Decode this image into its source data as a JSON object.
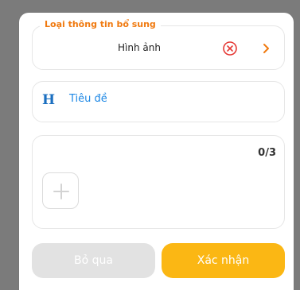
{
  "dialog": {
    "type_field": {
      "label": "Loại thông tin bổ sung",
      "value": "Hình ảnh",
      "clear_icon": "close-circle-icon",
      "chevron_icon": "chevron-right-icon"
    },
    "title_field": {
      "icon": "heading-icon",
      "placeholder": "Tiêu đề"
    },
    "media": {
      "counter": "0/3",
      "add_icon": "plus-icon"
    },
    "buttons": {
      "skip": "Bỏ qua",
      "confirm": "Xác nhận"
    },
    "colors": {
      "accent_orange": "#f07a10",
      "confirm_yellow": "#fbb714",
      "link_blue": "#1e88e5",
      "disabled_gray": "#e2e2e2"
    }
  }
}
